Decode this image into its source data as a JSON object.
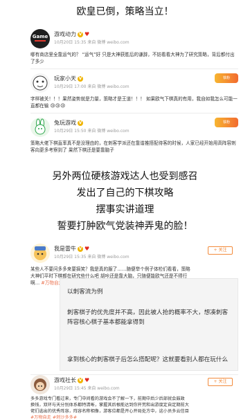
{
  "headline_top": "欧皇已倒，策略当立！",
  "posts": [
    {
      "author": "游戏动力",
      "meta": "10月20日 15:35 来自 微博 weibo.com",
      "body": "哪有商店里全靠运气的？ “运气”好 只是大神获胜后的谦辞，不妨看看大神为了研究策略，背后都付出了多少",
      "avatar_text": "Game 游戏动力"
    },
    {
      "author": "玩家小天",
      "meta": "10月29日 17:00 来自 微博 weibo.com",
      "body": "字样被关！！！果然姿势就是力量，策略才是王道！！！ 如果欧气下棋真的有用，我自如我怎么可能一直都在输",
      "badge": "铁粉"
    },
    {
      "author": "兔玩游戏",
      "meta": "10月29日 15:50 来自 微博 weibo.com",
      "body": "策略大佬下棋直率真不是没理由的，在刺客学派还在靠谱推搭配待客的时候，人家已经开始用高阵容刺客向更多考察到了 果然下棋还是要靠脑子",
      "badge": "铁粉"
    }
  ],
  "headline_middle": [
    "另外两位硬核游戏达人也受到感召",
    "发出了自己的下棋攻略",
    "摆事实讲道理",
    "誓要打肿欧气党装神弄鬼的脸！"
  ],
  "post4": {
    "author": "我是雷牛",
    "meta": "10月29日 15:35 来自 微博 weibo.com",
    "body_line1": "某些人不要问多多来要搞笑？我是真的服了……随便举个例子体检们看看，策略",
    "body_line2": "大神们平时下棋都在研究些什么吧 胡咔还是靠大脑，只随便能欧气还是不得行",
    "body_line3": "啊…",
    "tags": "#万物自走 #刺沙多多#",
    "follow": "+ 关注"
  },
  "quote": {
    "line1": "以刺客流为例",
    "line2": "刺客棋子的优先度并不高，因此被人抢的概率不大，想凑刺客",
    "line3": "阵容核心棋子基本都能拿得到",
    "line4": "拿到核心的刺客棋子后怎么搭配呢？这就要看别人都在玩什么"
  },
  "post5": {
    "author": "游戏社长",
    "meta": "10月29日 15:45 来自 weibo.com",
    "body_line1": "多多游戏专门看过来，专门中间看的游戏会不了解一下，前期中后少后部就会鼓政",
    "body_line2": "换钱，双环与天分别体系都特清晰，掌握其后根能达到你开荒和出游度定自定期前大",
    "body_line3": "佬们选出的优秀阵容，阵容名称相像，游客位都是开心开局处方中，这小员多云信目",
    "tags": "#万物自走 #刺沙多多#",
    "follow": "+ 关注"
  }
}
